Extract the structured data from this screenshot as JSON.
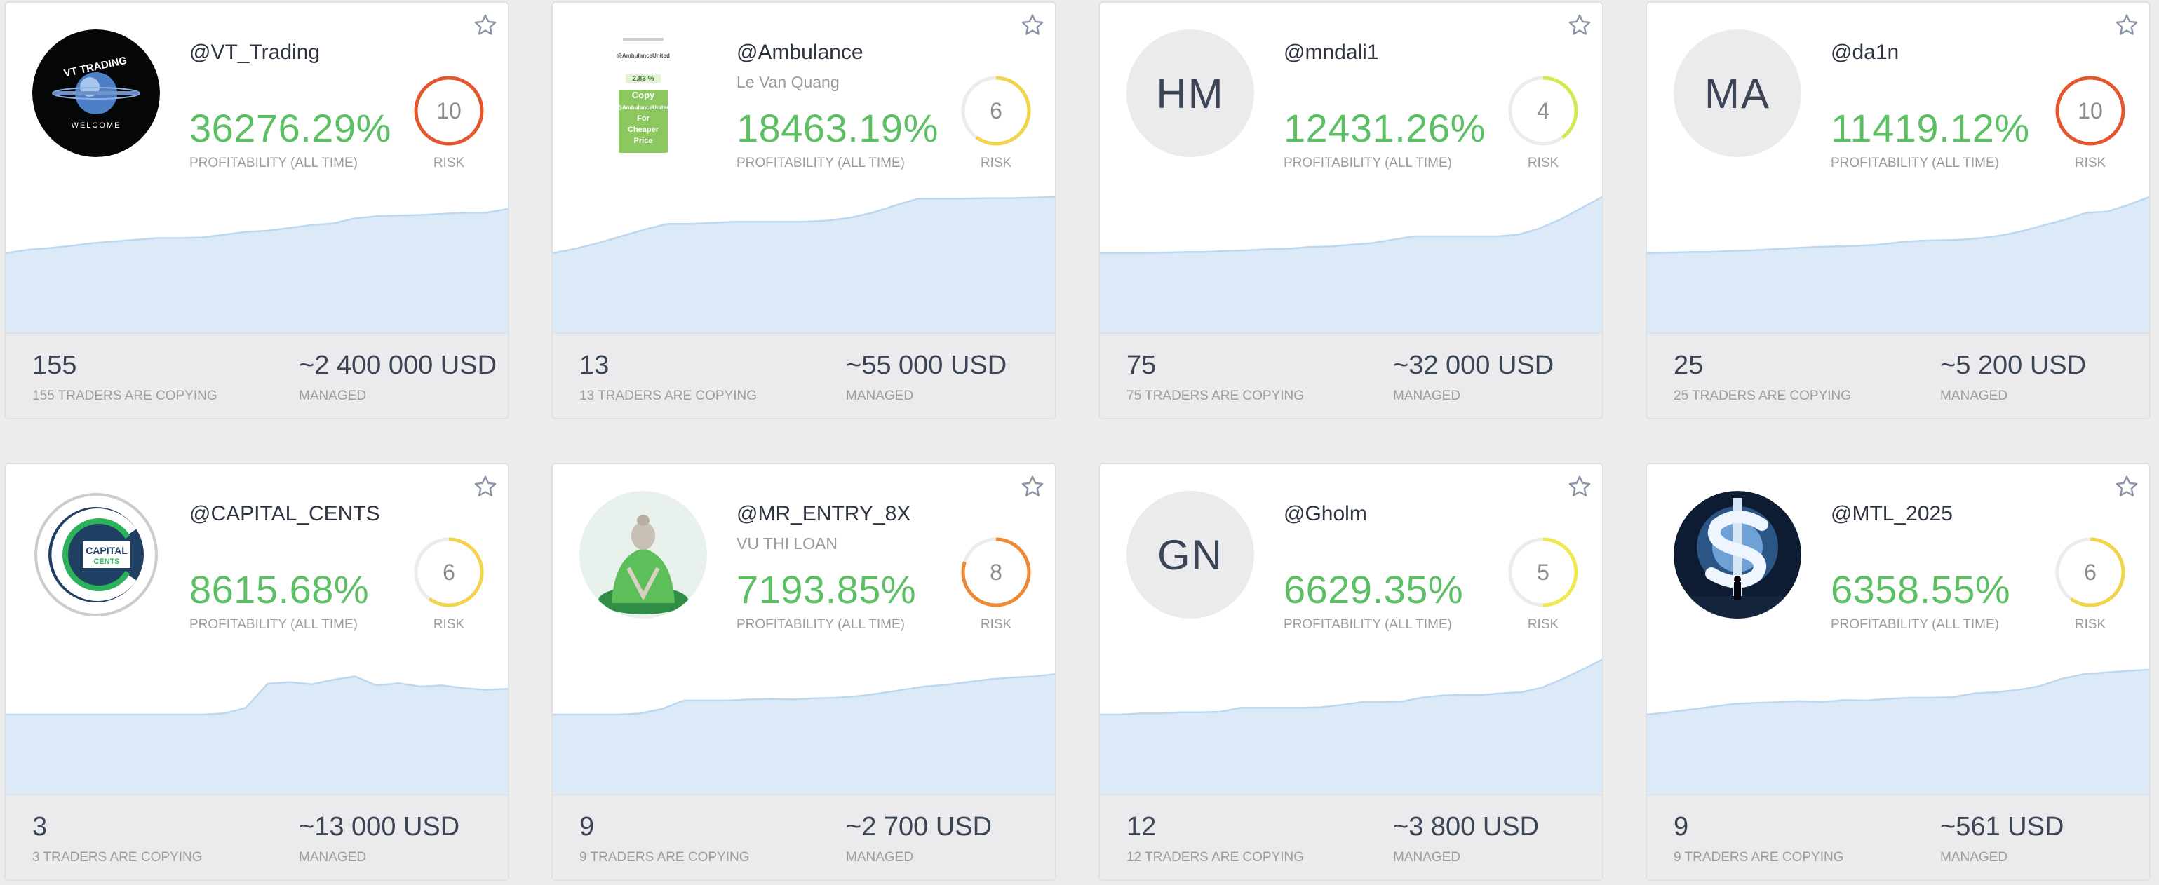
{
  "cards": [
    {
      "handle": "@VT_Trading",
      "subname": "",
      "profit": "36276.29%",
      "profit_label": "PROFITABILITY (ALL TIME)",
      "risk": "10",
      "risk_fraction": 1.0,
      "risk_color": "#e4572e",
      "risk_label": "RISK",
      "copiers": "155",
      "copiers_label": "155 TRADERS ARE COPYING",
      "managed": "~2 400 000 USD",
      "managed_label": "MANAGED",
      "avatar": {
        "type": "logo-globe",
        "logo_text": [
          "VT TRADING",
          "WELCOME"
        ]
      },
      "trend": [
        0.0,
        0.06,
        0.09,
        0.13,
        0.18,
        0.21,
        0.24,
        0.27,
        0.27,
        0.28,
        0.33,
        0.38,
        0.4,
        0.45,
        0.5,
        0.53,
        0.62,
        0.66,
        0.67,
        0.68,
        0.7,
        0.72,
        0.72,
        0.79
      ]
    },
    {
      "handle": "@Ambulance",
      "subname": "Le Van Quang",
      "profit": "18463.19%",
      "profit_label": "PROFITABILITY (ALL TIME)",
      "risk": "6",
      "risk_fraction": 0.6,
      "risk_color": "#f1d44b",
      "risk_label": "RISK",
      "copiers": "13",
      "copiers_label": "13 TRADERS ARE COPYING",
      "managed": "~55 000 USD",
      "managed_label": "MANAGED",
      "avatar": {
        "type": "logo-poster",
        "logo_text": [
          "@AmbulanceUnited",
          "2.83 %",
          "Copy",
          "@AmbulanceUnited",
          "For",
          "Cheaper",
          "Price"
        ]
      },
      "trend": [
        0.0,
        0.08,
        0.18,
        0.3,
        0.42,
        0.52,
        0.52,
        0.54,
        0.56,
        0.56,
        0.56,
        0.56,
        0.58,
        0.63,
        0.72,
        0.85,
        0.97,
        0.97,
        0.97,
        0.98,
        0.98,
        0.99,
        1.0
      ]
    },
    {
      "handle": "@mndali1",
      "subname": "",
      "profit": "12431.26%",
      "profit_label": "PROFITABILITY (ALL TIME)",
      "risk": "4",
      "risk_fraction": 0.4,
      "risk_color": "#d6e84f",
      "risk_label": "RISK",
      "copiers": "75",
      "copiers_label": "75 TRADERS ARE COPYING",
      "managed": "~32 000 USD",
      "managed_label": "MANAGED",
      "avatar": {
        "type": "initials",
        "initials": "HM"
      },
      "trend": [
        0.0,
        0.0,
        0.0,
        0.01,
        0.02,
        0.02,
        0.04,
        0.05,
        0.07,
        0.08,
        0.11,
        0.12,
        0.15,
        0.18,
        0.24,
        0.3,
        0.3,
        0.3,
        0.3,
        0.3,
        0.33,
        0.44,
        0.6,
        0.8,
        1.0
      ]
    },
    {
      "handle": "@da1n",
      "subname": "",
      "profit": "11419.12%",
      "profit_label": "PROFITABILITY (ALL TIME)",
      "risk": "10",
      "risk_fraction": 1.0,
      "risk_color": "#e4572e",
      "risk_label": "RISK",
      "copiers": "25",
      "copiers_label": "25 TRADERS ARE COPYING",
      "managed": "~5 200 USD",
      "managed_label": "MANAGED",
      "avatar": {
        "type": "initials",
        "initials": "MA"
      },
      "trend": [
        0.0,
        0.01,
        0.02,
        0.02,
        0.04,
        0.05,
        0.07,
        0.09,
        0.11,
        0.12,
        0.13,
        0.15,
        0.19,
        0.22,
        0.23,
        0.24,
        0.27,
        0.32,
        0.4,
        0.5,
        0.6,
        0.72,
        0.74,
        0.86,
        1.0
      ]
    },
    {
      "handle": "@CAPITAL_CENTS",
      "subname": "",
      "profit": "8615.68%",
      "profit_label": "PROFITABILITY (ALL TIME)",
      "risk": "6",
      "risk_fraction": 0.6,
      "risk_color": "#f1d44b",
      "risk_label": "RISK",
      "copiers": "3",
      "copiers_label": "3 TRADERS ARE COPYING",
      "managed": "~13 000 USD",
      "managed_label": "MANAGED",
      "avatar": {
        "type": "logo-capital",
        "logo_text": [
          "CAPITAL",
          "CENTS"
        ]
      },
      "trend": [
        0.0,
        0.0,
        0.0,
        0.0,
        0.0,
        0.0,
        0.0,
        0.0,
        0.0,
        0.0,
        0.02,
        0.12,
        0.55,
        0.58,
        0.54,
        0.62,
        0.68,
        0.52,
        0.56,
        0.5,
        0.52,
        0.47,
        0.44,
        0.46
      ]
    },
    {
      "handle": "@MR_ENTRY_8X",
      "subname": "VU THI LOAN",
      "profit": "7193.85%",
      "profit_label": "PROFITABILITY (ALL TIME)",
      "risk": "8",
      "risk_fraction": 0.8,
      "risk_color": "#ee8a36",
      "risk_label": "RISK",
      "copiers": "9",
      "copiers_label": "9 TRADERS ARE COPYING",
      "managed": "~2 700 USD",
      "managed_label": "MANAGED",
      "avatar": {
        "type": "logo-buddha"
      },
      "trend": [
        0.0,
        0.0,
        0.0,
        0.0,
        0.02,
        0.1,
        0.25,
        0.25,
        0.25,
        0.27,
        0.28,
        0.27,
        0.29,
        0.3,
        0.33,
        0.38,
        0.44,
        0.5,
        0.53,
        0.58,
        0.63,
        0.66,
        0.68,
        0.72
      ]
    },
    {
      "handle": "@Gholm",
      "subname": "",
      "profit": "6629.35%",
      "profit_label": "PROFITABILITY (ALL TIME)",
      "risk": "5",
      "risk_fraction": 0.5,
      "risk_color": "#eee94e",
      "risk_label": "RISK",
      "copiers": "12",
      "copiers_label": "12 TRADERS ARE COPYING",
      "managed": "~3 800 USD",
      "managed_label": "MANAGED",
      "avatar": {
        "type": "initials",
        "initials": "GN"
      },
      "trend": [
        0.0,
        0.0,
        0.02,
        0.02,
        0.04,
        0.04,
        0.05,
        0.12,
        0.12,
        0.12,
        0.12,
        0.13,
        0.17,
        0.22,
        0.22,
        0.23,
        0.3,
        0.34,
        0.35,
        0.35,
        0.38,
        0.4,
        0.48,
        0.63,
        0.8,
        0.98
      ]
    },
    {
      "handle": "@MTL_2025",
      "subname": "",
      "profit": "6358.55%",
      "profit_label": "PROFITABILITY (ALL TIME)",
      "risk": "6",
      "risk_fraction": 0.6,
      "risk_color": "#f1d44b",
      "risk_label": "RISK",
      "copiers": "9",
      "copiers_label": "9 TRADERS ARE COPYING",
      "managed": "~561 USD",
      "managed_label": "MANAGED",
      "avatar": {
        "type": "logo-dollar"
      },
      "trend": [
        0.0,
        0.04,
        0.09,
        0.14,
        0.19,
        0.21,
        0.22,
        0.24,
        0.22,
        0.26,
        0.25,
        0.28,
        0.3,
        0.3,
        0.31,
        0.38,
        0.4,
        0.44,
        0.51,
        0.64,
        0.72,
        0.75,
        0.78,
        0.8
      ]
    }
  ],
  "colors": {
    "profit": "#5dbf63",
    "chart_fill": "#dceaf7",
    "chart_line": "#bcd8f0"
  }
}
